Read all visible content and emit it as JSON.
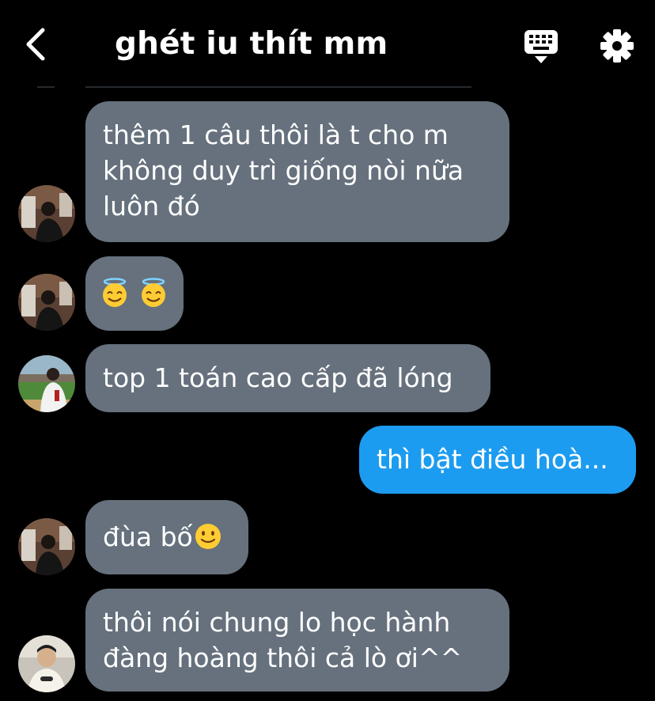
{
  "header": {
    "title": "ghét iu thít mm",
    "back_icon": "chevron-left-icon",
    "keyboard_icon": "keyboard-icon",
    "settings_icon": "gear-icon"
  },
  "colors": {
    "background": "#000000",
    "received_bubble": "#66717d",
    "sent_bubble": "#1c9cf0",
    "text": "#ffffff"
  },
  "messages": [
    {
      "direction": "received",
      "lines": [
        "thêm 1 câu thôi là t cho m",
        "không duy trì giống nòi nữa",
        "luôn đó"
      ]
    },
    {
      "direction": "received",
      "emoji": [
        "smiling-face-with-halo-icon",
        "smiling-face-with-halo-icon"
      ]
    },
    {
      "direction": "received",
      "lines": [
        "top 1 toán cao cấp đã lóng"
      ]
    },
    {
      "direction": "sent",
      "lines": [
        "thì bật điều hoà..."
      ]
    },
    {
      "direction": "received",
      "lines": [
        "đùa bố"
      ],
      "emoji": [
        "slightly-smiling-face-icon"
      ]
    },
    {
      "direction": "received",
      "lines": [
        "thôi nói chung lo học hành",
        "đàng hoàng thôi cả lò ơi^^"
      ]
    }
  ]
}
